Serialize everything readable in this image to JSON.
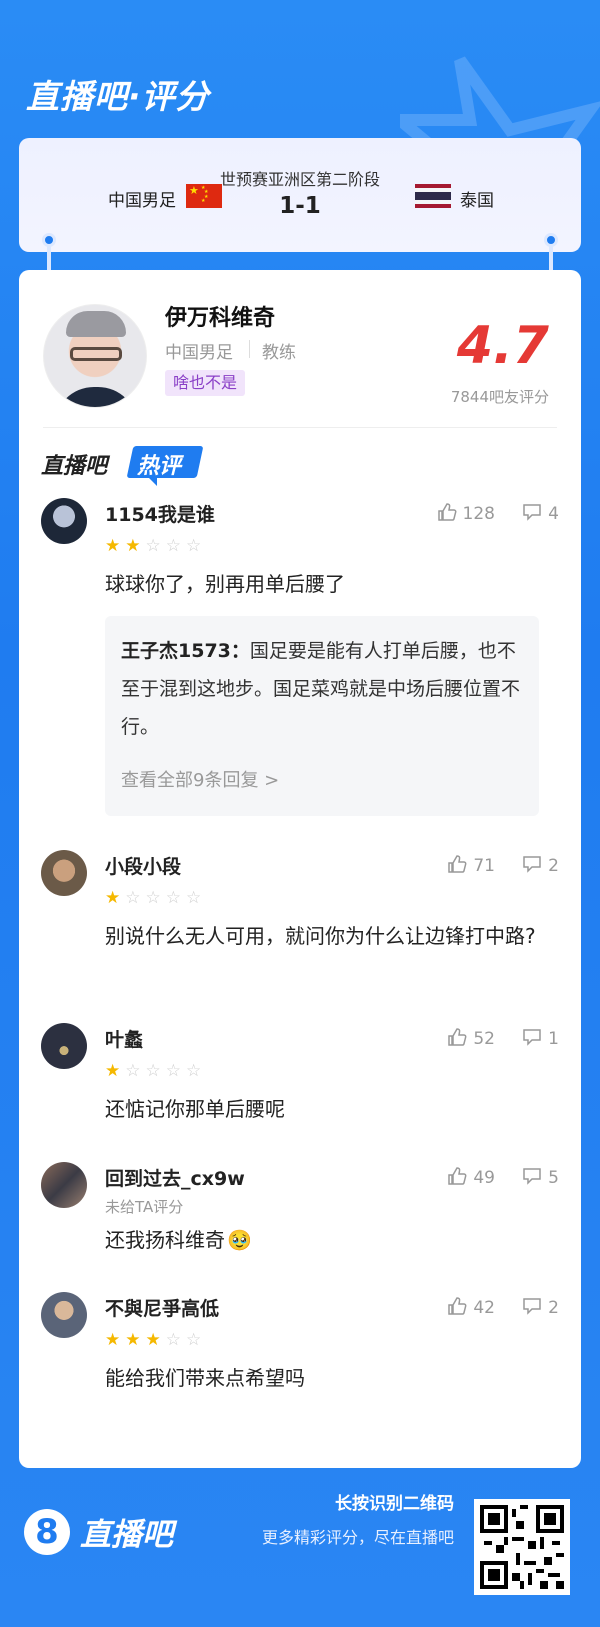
{
  "header": {
    "title": "直播吧·评分"
  },
  "match": {
    "stage": "世预赛亚洲区第二阶段",
    "score": "1-1",
    "home_team": "中国男足",
    "away_team": "泰国"
  },
  "coach": {
    "name": "伊万科维奇",
    "team": "中国男足",
    "role": "教练",
    "tag": "啥也不是",
    "score": "4.7",
    "rating_count": "7844吧友评分"
  },
  "hot": {
    "title_left": "直播吧",
    "title_badge": "热评"
  },
  "comments": [
    {
      "user": "1154我是谁",
      "stars": 2,
      "likes": "128",
      "replies": "4",
      "text": "球球你了，别再用单后腰了",
      "reply": {
        "user": "王子杰1573：",
        "text": "国足要是能有人打单后腰，也不至于混到这地步。国足菜鸡就是中场后腰位置不行。",
        "more": "查看全部9条回复 >"
      }
    },
    {
      "user": "小段小段",
      "stars": 1,
      "likes": "71",
      "replies": "2",
      "text": "别说什么无人可用，就问你为什么让边锋打中路?"
    },
    {
      "user": "叶蠡",
      "stars": 1,
      "likes": "52",
      "replies": "1",
      "text": "还惦记你那单后腰呢"
    },
    {
      "user": "回到过去_cx9w",
      "unrated": "未给TA评分",
      "likes": "49",
      "replies": "5",
      "text": "还我扬科维奇",
      "emoji": "🥹"
    },
    {
      "user": "不與尼爭高低",
      "stars": 3,
      "likes": "42",
      "replies": "2",
      "text": "能给我们带来点希望吗"
    }
  ],
  "footer": {
    "logo_digit": "8",
    "brand": "直播吧",
    "qr_label": "长按识别二维码",
    "qr_sub": "更多精彩评分，尽在直播吧"
  },
  "colors": {
    "brand_blue": "#1f7cf0",
    "score_red": "#e53935",
    "tag_purple": "#8a3fc7",
    "star_gold": "#f5b800"
  }
}
